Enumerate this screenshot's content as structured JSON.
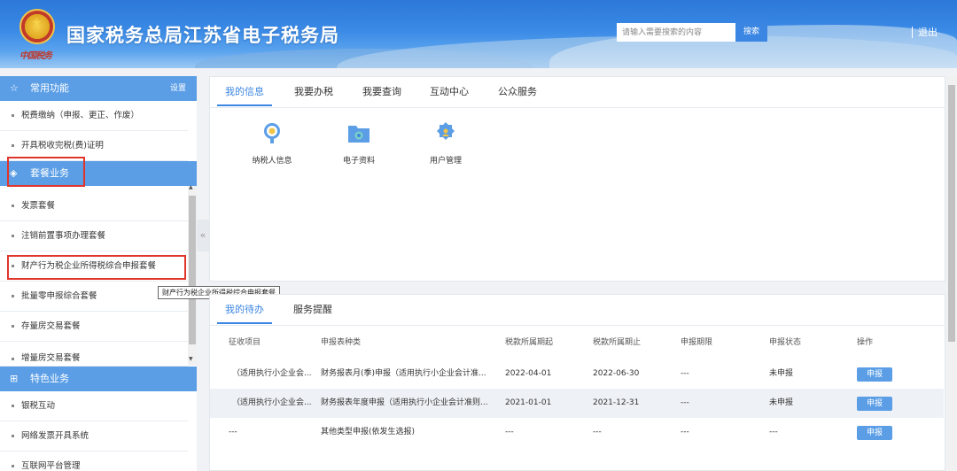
{
  "header": {
    "site_title": "国家税务总局江苏省电子税务局",
    "emblem_signature": "中国税务",
    "search_placeholder": "请输入需要搜索的内容",
    "search_button": "搜索",
    "logout": "退出"
  },
  "sidebar": {
    "common": {
      "title": "常用功能",
      "setting": "设置",
      "icon": "star-icon"
    },
    "common_items": [
      "税费缴纳（申报、更正、作废）",
      "开具税收完税(费)证明"
    ],
    "package": {
      "title": "套餐业务",
      "icon": "layers-icon"
    },
    "package_items": [
      "发票套餐",
      "注销前置事项办理套餐",
      "财产行为税企业所得税综合申报套餐",
      "批量零申报综合套餐",
      "存量房交易套餐",
      "增量房交易套餐"
    ],
    "special": {
      "title": "特色业务",
      "icon": "grid-icon"
    },
    "special_items": [
      "银税互动",
      "网络发票开具系统",
      "互联网平台管理"
    ],
    "tooltip": "财产行为税企业所得税综合申报套餐"
  },
  "info_panel": {
    "tabs": [
      "我的信息",
      "我要办税",
      "我要查询",
      "互动中心",
      "公众服务"
    ],
    "active_tab": 0,
    "apps": [
      {
        "label": "纳税人信息",
        "icon": "taxpayer-info-icon"
      },
      {
        "label": "电子资料",
        "icon": "folder-icon"
      },
      {
        "label": "用户管理",
        "icon": "user-gear-icon"
      }
    ]
  },
  "todo_panel": {
    "tabs": [
      "我的待办",
      "服务提醒"
    ],
    "active_tab": 0,
    "columns": [
      "征收项目",
      "申报表种类",
      "税款所属期起",
      "税款所属期止",
      "申报期限",
      "申报状态",
      "操作"
    ],
    "rows": [
      [
        "（适用执行小企业会...",
        "财务报表月(季)申报（适用执行小企业会计准...",
        "2022-04-01",
        "2022-06-30",
        "---",
        "未申报",
        "申报"
      ],
      [
        "（适用执行小企业会...",
        "财务报表年度申报（适用执行小企业会计准则...",
        "2021-01-01",
        "2021-12-31",
        "---",
        "未申报",
        "申报"
      ],
      [
        "---",
        "其他类型申报(依发生选报)",
        "---",
        "---",
        "---",
        "---",
        "申报"
      ]
    ]
  },
  "colors": {
    "primary": "#3c86e3",
    "sidebar_header": "#5b9ee6",
    "highlight_box": "#e0352b"
  }
}
